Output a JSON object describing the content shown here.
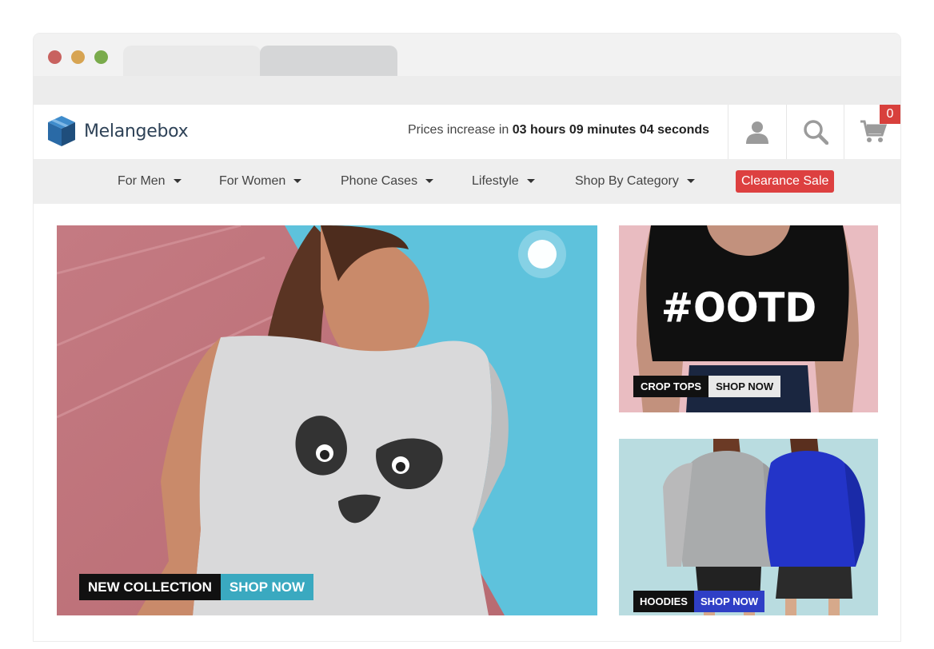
{
  "brand": {
    "name": "Melangebox"
  },
  "countdown": {
    "prefix": "Prices increase in",
    "time": "03 hours 09 minutes 04 seconds"
  },
  "header": {
    "account_icon": "user-icon",
    "search_icon": "search-icon",
    "cart_icon": "cart-icon",
    "cart_count": "0"
  },
  "nav": {
    "items": [
      {
        "label": "For Men"
      },
      {
        "label": "For Women"
      },
      {
        "label": "Phone Cases"
      },
      {
        "label": "Lifestyle"
      },
      {
        "label": "Shop By Category"
      }
    ],
    "sale_label": "Clearance Sale"
  },
  "hero": {
    "badge": "NEW COLLECTION",
    "cta": "SHOP NOW"
  },
  "promos": {
    "crop": {
      "print": "#OOTD",
      "badge": "CROP TOPS",
      "cta": "SHOP NOW"
    },
    "hoodies": {
      "badge": "HOODIES",
      "cta": "SHOP NOW"
    }
  },
  "colors": {
    "sale": "#dd4040",
    "hero_cta": "#3aa9c0",
    "hoodie_cta": "#2f3fc6",
    "brand_text": "#2e4257"
  }
}
